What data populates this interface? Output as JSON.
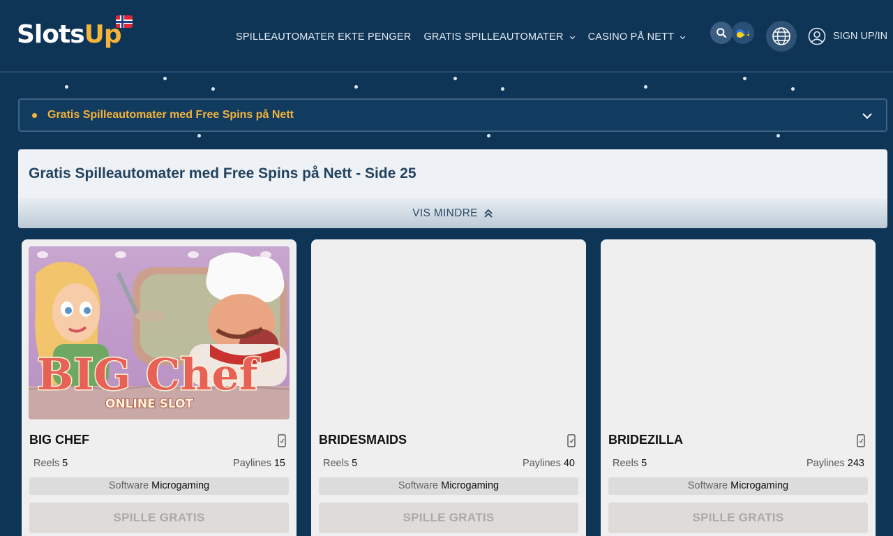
{
  "logo": {
    "part1": "SlotsUp",
    "slots": "Slots",
    "up": "Up"
  },
  "nav": {
    "items": [
      {
        "label": "SPILLEAUTOMATER EKTE PENGER",
        "has_dropdown": false
      },
      {
        "label": "GRATIS SPILLEAUTOMATER",
        "has_dropdown": true
      },
      {
        "label": "CASINO PÅ NETT",
        "has_dropdown": true
      }
    ],
    "signup_label": "SIGN UP/IN"
  },
  "breadcrumb": {
    "label": "Gratis Spilleautomater med Free Spins på Nett"
  },
  "page": {
    "title": "Gratis Spilleautomater med Free Spins på Nett - Side 25",
    "toggle_label": "VIS MINDRE"
  },
  "games": [
    {
      "name": "BIG CHEF",
      "reels_label": "Reels",
      "reels": "5",
      "paylines_label": "Paylines",
      "paylines": "15",
      "software_label": "Software",
      "software": "Microgaming",
      "play_label": "SPILLE GRATIS",
      "image": {
        "title": "BIG Chef",
        "subtitle": "ONLINE SLOT"
      }
    },
    {
      "name": "BRIDESMAIDS",
      "reels_label": "Reels",
      "reels": "5",
      "paylines_label": "Paylines",
      "paylines": "40",
      "software_label": "Software",
      "software": "Microgaming",
      "play_label": "SPILLE GRATIS"
    },
    {
      "name": "BRIDEZILLA",
      "reels_label": "Reels",
      "reels": "5",
      "paylines_label": "Paylines",
      "paylines": "243",
      "software_label": "Software",
      "software": "Microgaming",
      "play_label": "SPILLE GRATIS"
    }
  ],
  "colors": {
    "background": "#0e3456",
    "accent": "#f6b53a",
    "card": "#efefef"
  },
  "icons": [
    "search-icon",
    "ukraine-flag-icon",
    "globe-icon",
    "user-icon",
    "chevron-down-icon",
    "double-chevron-up-icon",
    "mobile-icon"
  ]
}
